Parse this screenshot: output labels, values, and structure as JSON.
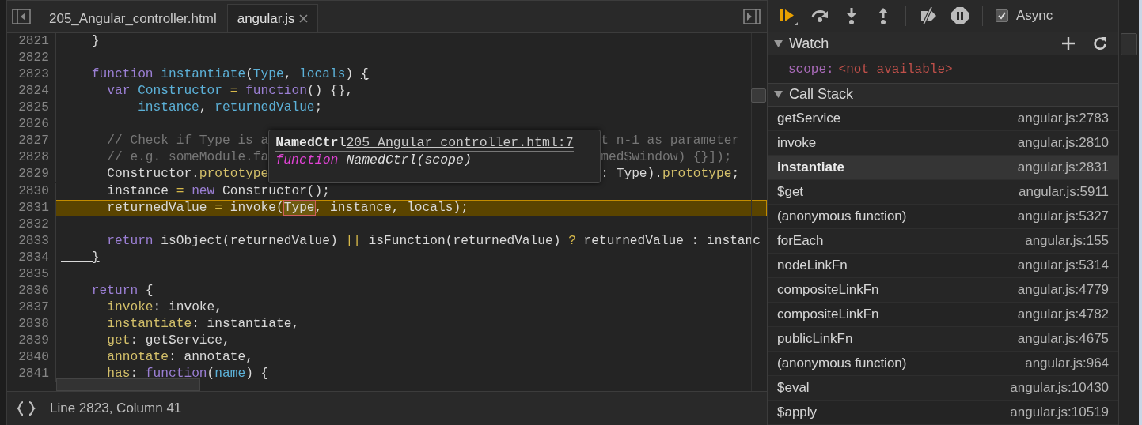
{
  "editor": {
    "tabs": [
      {
        "label": "205_Angular_controller.html",
        "selected": false,
        "closable": false
      },
      {
        "label": "angular.js",
        "selected": true,
        "closable": true
      }
    ],
    "lines_before": [
      {
        "number": "2821",
        "current": false,
        "tokens": [
          {
            "text": "    }",
            "kind": "plain"
          }
        ]
      },
      {
        "number": "2822",
        "current": false
      },
      {
        "number": "2823",
        "current": false,
        "tokens": [
          {
            "text": "    function",
            "kind": "kw"
          },
          {
            "text": " instantiate",
            "kind": "def"
          },
          {
            "text": "(",
            "kind": "plain"
          },
          {
            "text": "Type",
            "kind": "def"
          },
          {
            "text": ",",
            "kind": "plain"
          },
          {
            "text": " locals",
            "kind": "def"
          },
          {
            "text": ") ",
            "kind": "plain"
          },
          {
            "text": "{",
            "kind": "match"
          }
        ]
      },
      {
        "number": "2824",
        "current": false,
        "tokens": [
          {
            "text": "      var",
            "kind": "kw"
          },
          {
            "text": " Constructor",
            "kind": "def"
          },
          {
            "text": " =",
            "kind": "op"
          },
          {
            "text": " function",
            "kind": "kw"
          },
          {
            "text": "() {},",
            "kind": "plain"
          }
        ]
      },
      {
        "number": "2825",
        "current": false,
        "tokens": [
          {
            "text": "          instance",
            "kind": "def"
          },
          {
            "text": ", ",
            "kind": "plain"
          },
          {
            "text": "returnedValue",
            "kind": "def"
          },
          {
            "text": ";",
            "kind": "plain"
          }
        ]
      },
      {
        "number": "2826",
        "current": false
      }
    ],
    "popup_rows": [
      {
        "number": "2827",
        "left": [
          {
            "text": "      // Check if Type is a",
            "kind": "comment"
          }
        ],
        "right": [
          {
            "text": "t n-1 as parameter",
            "kind": "comment"
          }
        ]
      },
      {
        "number": "2828",
        "left": [
          {
            "text": "      // e.g. someModule.fa",
            "kind": "comment"
          }
        ],
        "right": [
          {
            "text": "med$window) {}]);",
            "kind": "comment"
          }
        ]
      },
      {
        "number": "2829",
        "left": [
          {
            "text": "      Constructor.",
            "kind": "plain"
          },
          {
            "text": "prototype",
            "kind": "prop"
          }
        ],
        "right": [
          {
            "text": ": Type).",
            "kind": "plain"
          },
          {
            "text": "prototype",
            "kind": "prop"
          },
          {
            "text": ";",
            "kind": "plain"
          }
        ]
      }
    ],
    "tooltip": {
      "name": "NamedCtrl",
      "link": "205_Angular_controller.html:7",
      "keyword": "function",
      "signature": " NamedCtrl(scope)"
    },
    "lines_after": [
      {
        "number": "2830",
        "current": false,
        "tokens": [
          {
            "text": "      instance ",
            "kind": "plain"
          },
          {
            "text": "=",
            "kind": "op"
          },
          {
            "text": " new",
            "kind": "kw"
          },
          {
            "text": " Constructor();",
            "kind": "plain"
          }
        ]
      },
      {
        "number": "2831",
        "current": true,
        "tokens": [
          {
            "text": "      returnedValue ",
            "kind": "plain"
          },
          {
            "text": "=",
            "kind": "op"
          },
          {
            "text": " invoke(",
            "kind": "plain"
          },
          {
            "text": "Type",
            "kind": "hover"
          },
          {
            "text": ", instance, locals);",
            "kind": "plain"
          }
        ]
      },
      {
        "number": "2832",
        "current": false
      },
      {
        "number": "2833",
        "current": false,
        "tokens": [
          {
            "text": "      return",
            "kind": "kw"
          },
          {
            "text": " isObject(returnedValue) ",
            "kind": "plain"
          },
          {
            "text": "||",
            "kind": "op"
          },
          {
            "text": " isFunction(returnedValue) ",
            "kind": "plain"
          },
          {
            "text": "?",
            "kind": "op"
          },
          {
            "text": " returnedValue : instanc",
            "kind": "plain"
          }
        ]
      },
      {
        "number": "2834",
        "current": false,
        "tokens": [
          {
            "text": "    }",
            "kind": "match"
          }
        ]
      },
      {
        "number": "2835",
        "current": false
      },
      {
        "number": "2836",
        "current": false,
        "tokens": [
          {
            "text": "    return",
            "kind": "kw"
          },
          {
            "text": " {",
            "kind": "plain"
          }
        ]
      },
      {
        "number": "2837",
        "current": false,
        "tokens": [
          {
            "text": "      invoke",
            "kind": "prop"
          },
          {
            "text": ": invoke,",
            "kind": "plain"
          }
        ]
      },
      {
        "number": "2838",
        "current": false,
        "tokens": [
          {
            "text": "      instantiate",
            "kind": "prop"
          },
          {
            "text": ": instantiate,",
            "kind": "plain"
          }
        ]
      },
      {
        "number": "2839",
        "current": false,
        "tokens": [
          {
            "text": "      get",
            "kind": "prop"
          },
          {
            "text": ": getService,",
            "kind": "plain"
          }
        ]
      },
      {
        "number": "2840",
        "current": false,
        "tokens": [
          {
            "text": "      annotate",
            "kind": "prop"
          },
          {
            "text": ": annotate,",
            "kind": "plain"
          }
        ]
      },
      {
        "number": "2841",
        "current": false,
        "tokens": [
          {
            "text": "      has",
            "kind": "prop"
          },
          {
            "text": ": ",
            "kind": "plain"
          },
          {
            "text": "function",
            "kind": "kw"
          },
          {
            "text": "(",
            "kind": "plain"
          },
          {
            "text": "name",
            "kind": "def"
          },
          {
            "text": ") {",
            "kind": "plain"
          }
        ]
      }
    ]
  },
  "status_bar": {
    "text": "Line 2823, Column 41"
  },
  "debugger": {
    "async": {
      "label": "Async",
      "checked": true
    },
    "watch": {
      "title": "Watch",
      "expanded": true,
      "expressions": [
        {
          "name": "scope:",
          "value": "<not available>"
        }
      ]
    },
    "call_stack": {
      "title": "Call Stack",
      "expanded": true,
      "frames": [
        {
          "function": "getService",
          "location": "angular.js:2783",
          "selected": false
        },
        {
          "function": "invoke",
          "location": "angular.js:2810",
          "selected": false
        },
        {
          "function": "instantiate",
          "location": "angular.js:2831",
          "selected": true
        },
        {
          "function": "$get",
          "location": "angular.js:5911",
          "selected": false
        },
        {
          "function": "(anonymous function)",
          "location": "angular.js:5327",
          "selected": false
        },
        {
          "function": "forEach",
          "location": "angular.js:155",
          "selected": false
        },
        {
          "function": "nodeLinkFn",
          "location": "angular.js:5314",
          "selected": false
        },
        {
          "function": "compositeLinkFn",
          "location": "angular.js:4779",
          "selected": false
        },
        {
          "function": "compositeLinkFn",
          "location": "angular.js:4782",
          "selected": false
        },
        {
          "function": "publicLinkFn",
          "location": "angular.js:4675",
          "selected": false
        },
        {
          "function": "(anonymous function)",
          "location": "angular.js:964",
          "selected": false
        },
        {
          "function": "$eval",
          "location": "angular.js:10430",
          "selected": false
        },
        {
          "function": "$apply",
          "location": "angular.js:10519",
          "selected": false
        }
      ]
    }
  }
}
